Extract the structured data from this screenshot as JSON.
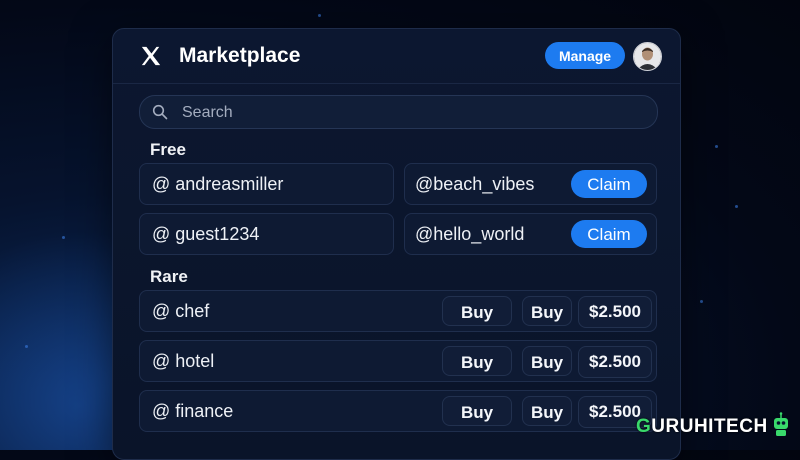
{
  "header": {
    "title": "Marketplace",
    "manage_label": "Manage",
    "logo_icon": "x-logo-icon",
    "avatar_icon": "user-avatar"
  },
  "search": {
    "placeholder": "Search",
    "icon": "search-icon"
  },
  "sections": {
    "free_label": "Free",
    "rare_label": "Rare"
  },
  "free_handles": [
    {
      "handle": "@ andreasmiller"
    },
    {
      "handle": "@beach_vibes",
      "action": "Claim"
    },
    {
      "handle": "@ guest1234"
    },
    {
      "handle": "@hello_world",
      "action": "Claim"
    }
  ],
  "rare_handles": [
    {
      "handle": "@ chef",
      "buy1": "Buy",
      "buy2": "Buy",
      "price": "$2.500"
    },
    {
      "handle": "@ hotel",
      "buy1": "Buy",
      "buy2": "Buy",
      "price": "$2.500"
    },
    {
      "handle": "@ finance",
      "buy1": "Buy",
      "buy2": "Buy",
      "price": "$2.500"
    }
  ],
  "watermark": {
    "text": "URUHITECH",
    "accent_letter": "G"
  },
  "colors": {
    "accent": "#1d7bf0",
    "background": "#030817",
    "panel": "#0c1730",
    "watermark_green": "#39d96b"
  }
}
